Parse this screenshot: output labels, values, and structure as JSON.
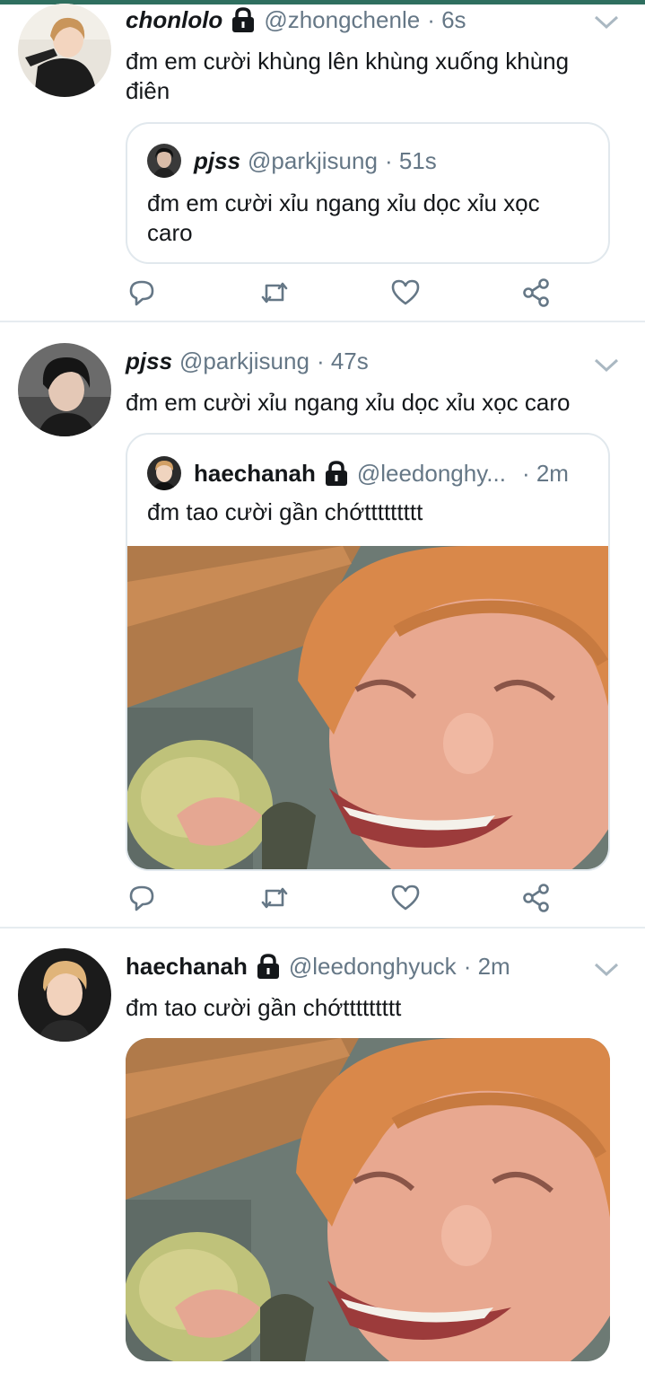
{
  "tweets": [
    {
      "name": "chonlolo",
      "protected": true,
      "handle": "@zhongchenle",
      "time": "· 6s",
      "text": "đm em cười khùng lên khùng xuống khùng điên",
      "quote": {
        "name": "pjss",
        "handle": "@parkjisung",
        "time": "· 51s",
        "text": "đm em cười xỉu ngang xỉu dọc xỉu xọc caro"
      }
    },
    {
      "name": "pjss",
      "protected": false,
      "handle": "@parkjisung",
      "time": "· 47s",
      "text": "đm em cười xỉu ngang xỉu dọc xỉu xọc caro",
      "quote": {
        "name": "haechanah",
        "protected": true,
        "handle": "@leedonghy...",
        "time": "· 2m",
        "text": "đm tao cười gần chớttttttttt"
      }
    },
    {
      "name": "haechanah",
      "protected": true,
      "handle": "@leedonghyuck",
      "time": "· 2m",
      "text": "đm tao cười gần chớttttttttt"
    }
  ],
  "icons": {
    "reply": "reply-icon",
    "retweet": "retweet-icon",
    "like": "heart-icon",
    "share": "share-icon",
    "lock": "lock-icon",
    "menu": "chevron-down-icon"
  },
  "colors": {
    "text": "#14171a",
    "secondary": "#657786",
    "divider": "#e6ecf0",
    "icon": "#657786"
  }
}
